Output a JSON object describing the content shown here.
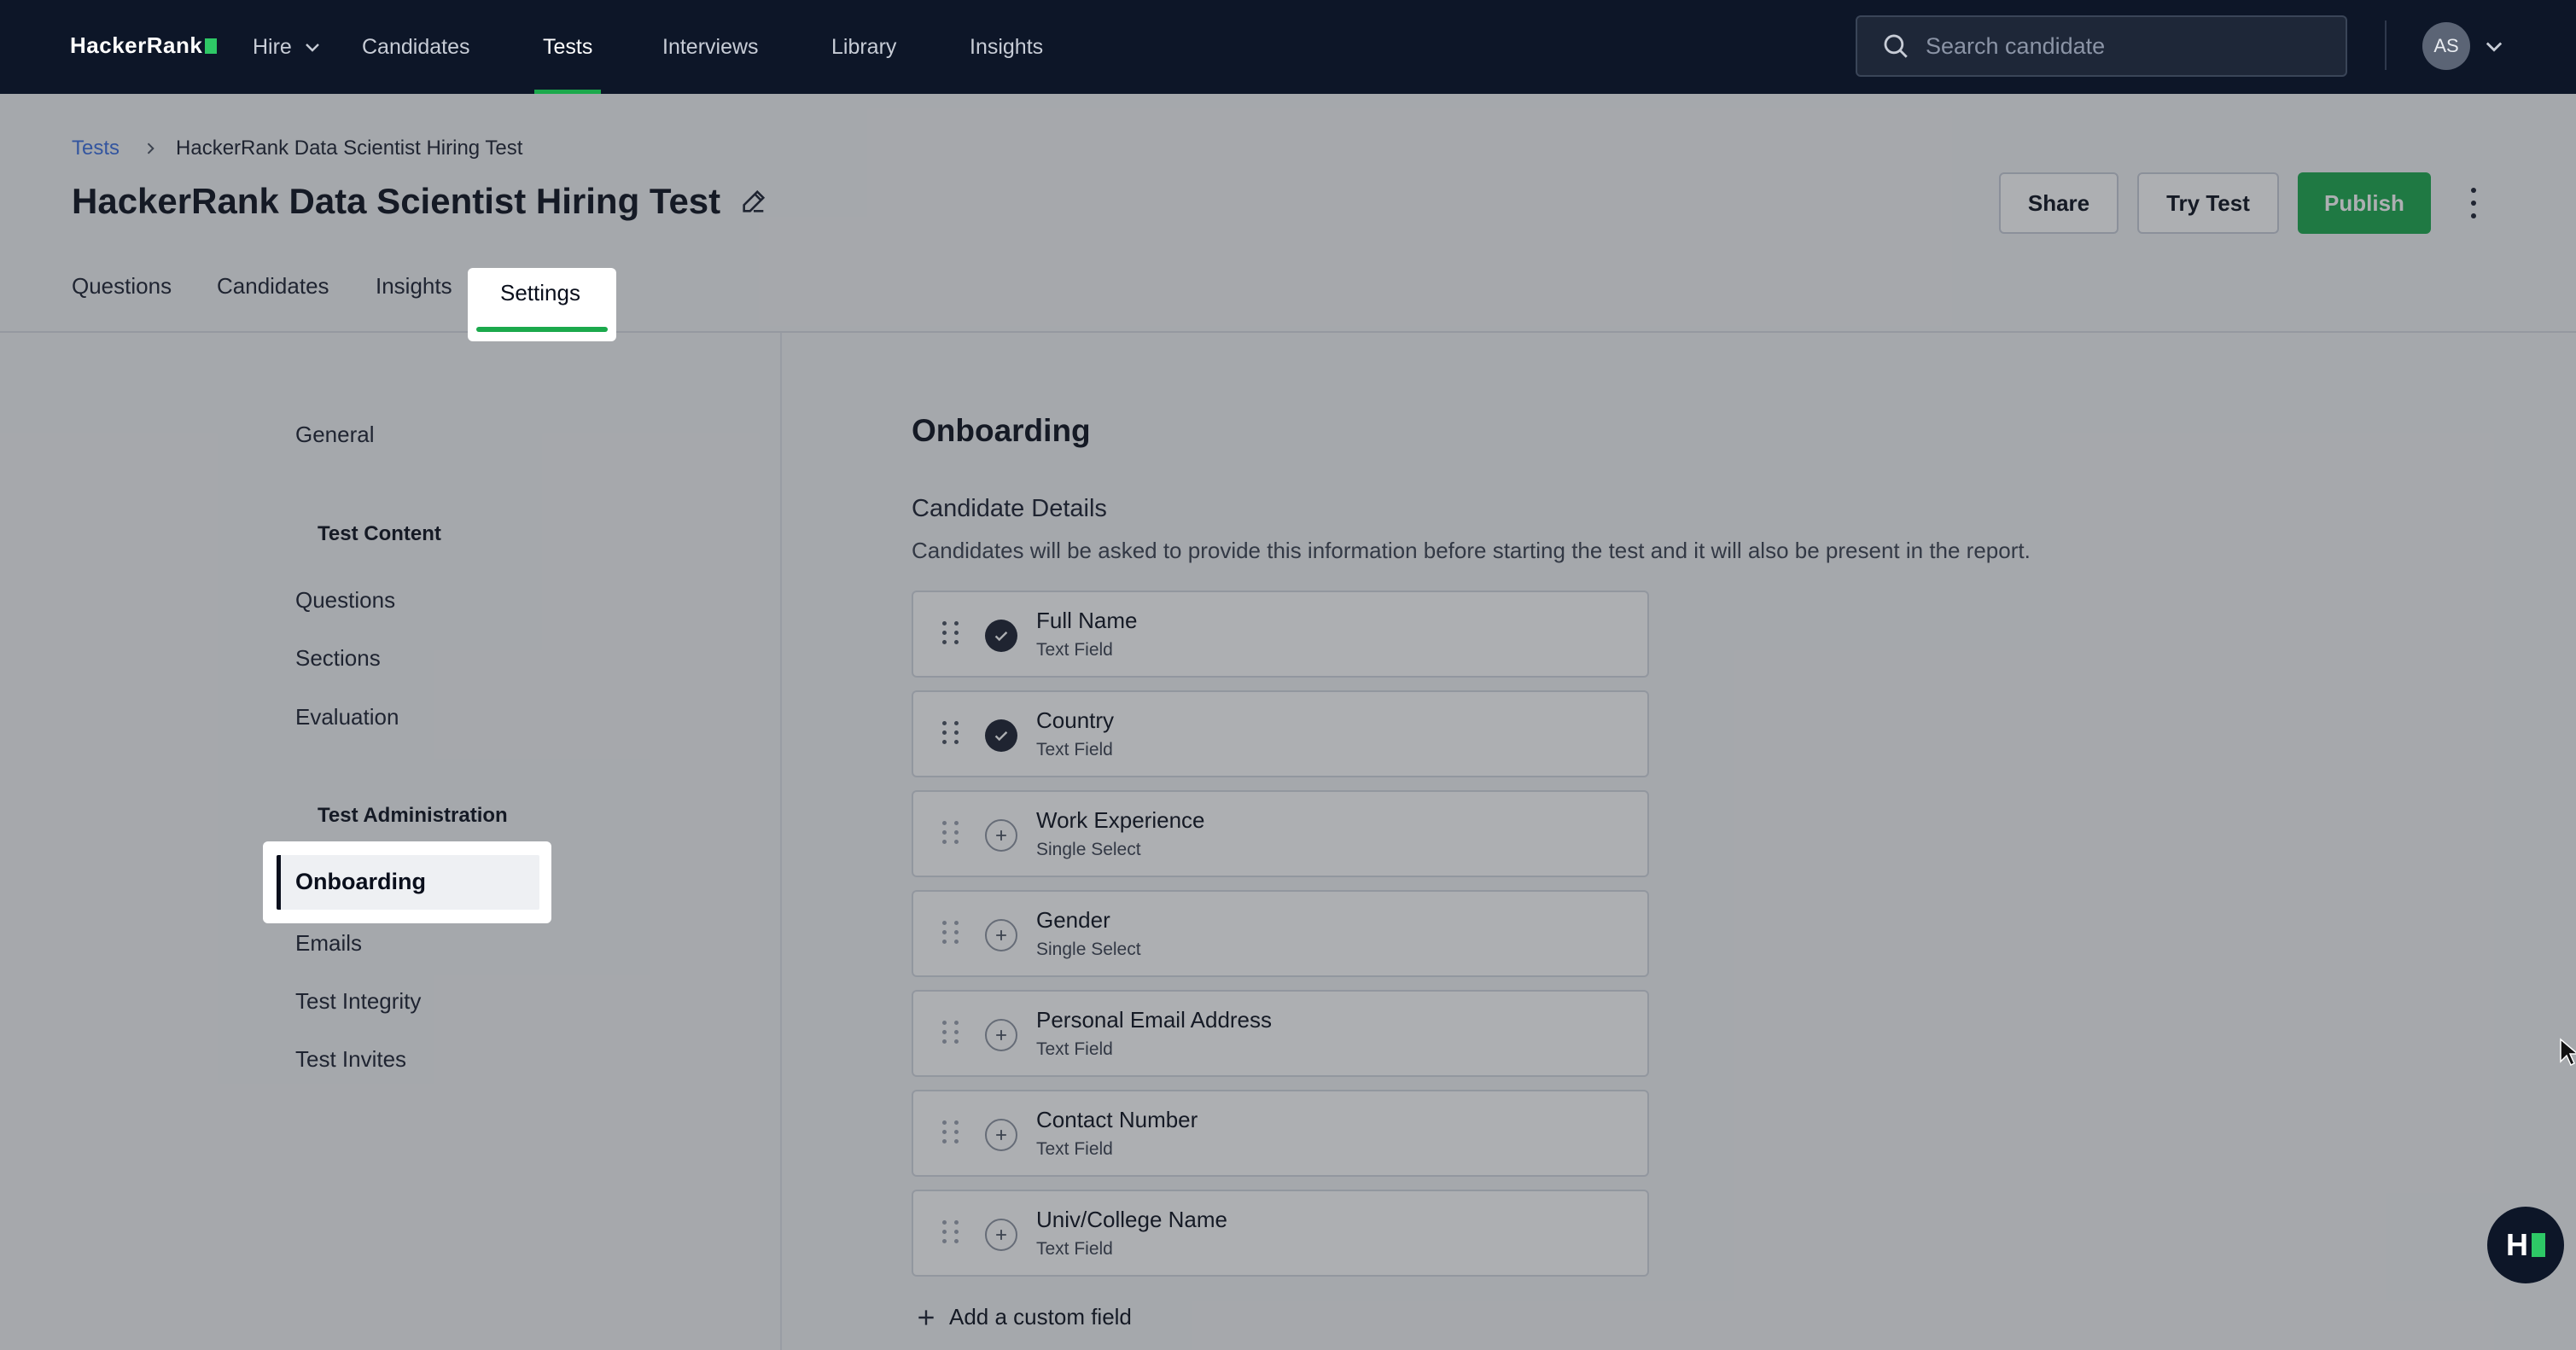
{
  "nav": {
    "logo": "HackerRank",
    "items": [
      "Hire",
      "Candidates",
      "Tests",
      "Interviews",
      "Library",
      "Insights"
    ],
    "active": "Tests",
    "search_placeholder": "Search candidate",
    "avatar_initials": "AS"
  },
  "breadcrumb": {
    "root": "Tests",
    "current": "HackerRank Data Scientist Hiring Test"
  },
  "page": {
    "title": "HackerRank Data Scientist Hiring Test"
  },
  "actions": {
    "share": "Share",
    "try": "Try Test",
    "publish": "Publish"
  },
  "tabs": [
    "Questions",
    "Candidates",
    "Insights",
    "Settings"
  ],
  "active_tab": "Settings",
  "sidebar": {
    "general": "General",
    "group_content": "Test Content",
    "content_items": [
      "Questions",
      "Sections",
      "Evaluation"
    ],
    "group_admin": "Test Administration",
    "admin_items": [
      "Onboarding",
      "Emails",
      "Test Integrity",
      "Test Invites"
    ],
    "active": "Onboarding"
  },
  "main": {
    "title": "Onboarding",
    "subtitle": "Candidate Details",
    "description": "Candidates will be asked to provide this information before starting the test and it will also be present in the report.",
    "fields": [
      {
        "name": "Full Name",
        "type": "Text Field",
        "checked": true
      },
      {
        "name": "Country",
        "type": "Text Field",
        "checked": true
      },
      {
        "name": "Work Experience",
        "type": "Single Select",
        "checked": false
      },
      {
        "name": "Gender",
        "type": "Single Select",
        "checked": false
      },
      {
        "name": "Personal Email Address",
        "type": "Text Field",
        "checked": false
      },
      {
        "name": "Contact Number",
        "type": "Text Field",
        "checked": false
      },
      {
        "name": "Univ/College Name",
        "type": "Text Field",
        "checked": false
      }
    ],
    "add_custom": "Add a custom field"
  },
  "colors": {
    "nav_bg": "#0d1628",
    "accent": "#1ba94c",
    "link": "#3b6fe0"
  }
}
